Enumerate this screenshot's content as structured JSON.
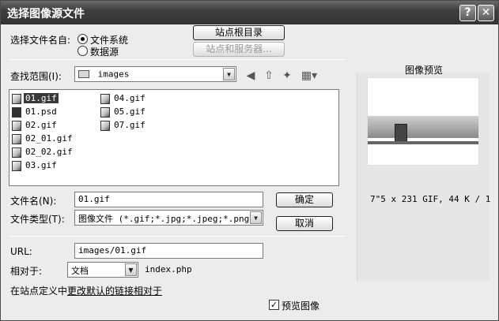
{
  "window": {
    "title": "选择图像源文件"
  },
  "titlebar": {
    "help_label": "?",
    "close_label": "✕"
  },
  "select_filename_from": {
    "label": "选择文件名自:",
    "option_filesystem": "文件系统",
    "option_datasource": "数据源",
    "selected": "文件系统"
  },
  "buttons": {
    "site_root": "站点根目录",
    "site_and_server": "站点和服务器...",
    "ok": "确定",
    "cancel": "取消"
  },
  "look_in": {
    "label": "查找范围(I):",
    "value": "images"
  },
  "files": [
    {
      "name": "01.gif",
      "type": "gif",
      "selected": true
    },
    {
      "name": "01.psd",
      "type": "psd",
      "selected": false
    },
    {
      "name": "02.gif",
      "type": "gif",
      "selected": false
    },
    {
      "name": "02_01.gif",
      "type": "gif",
      "selected": false
    },
    {
      "name": "02_02.gif",
      "type": "gif",
      "selected": false
    },
    {
      "name": "03.gif",
      "type": "gif",
      "selected": false
    },
    {
      "name": "04.gif",
      "type": "gif",
      "selected": false
    },
    {
      "name": "05.gif",
      "type": "gif",
      "selected": false
    },
    {
      "name": "07.gif",
      "type": "gif",
      "selected": false
    }
  ],
  "filename": {
    "label": "文件名(N):",
    "value": "01.gif"
  },
  "filetype": {
    "label": "文件类型(T):",
    "value": "图像文件 (*.gif;*.jpg;*.jpeg;*.png;*"
  },
  "url": {
    "label": "URL:",
    "value": "images/01.gif"
  },
  "relative_to": {
    "label": "相对于:",
    "value": "文档",
    "file": "index.php"
  },
  "link": {
    "prefix": "在站点定义中",
    "text": "更改默认的链接相对于"
  },
  "preview": {
    "title": "图像预览",
    "info": "7\"5 x 231 GIF, 44 K / 1",
    "checkbox_label": "预览图像",
    "checked": true
  },
  "colors": {
    "titlebar": "#3f3f3f",
    "selection": "#3a3a3a",
    "link": "#000000"
  }
}
